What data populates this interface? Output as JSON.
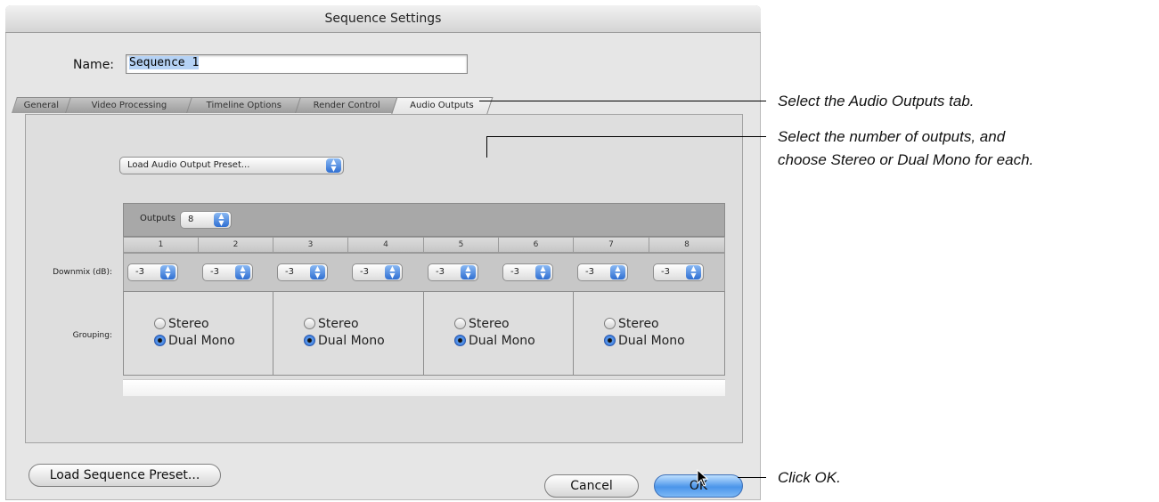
{
  "window": {
    "title": "Sequence Settings"
  },
  "name_field": {
    "label": "Name:",
    "value": "Sequence 1"
  },
  "tabs": [
    {
      "label": "General",
      "active": false
    },
    {
      "label": "Video Processing",
      "active": false
    },
    {
      "label": "Timeline Options",
      "active": false
    },
    {
      "label": "Render Control",
      "active": false
    },
    {
      "label": "Audio Outputs",
      "active": true
    }
  ],
  "preset_popup": {
    "label": "Load Audio Output Preset..."
  },
  "outputs": {
    "label": "Outputs",
    "value": "8"
  },
  "columns": [
    "1",
    "2",
    "3",
    "4",
    "5",
    "6",
    "7",
    "8"
  ],
  "downmix": {
    "label": "Downmix (dB):",
    "values": [
      "-3",
      "-3",
      "-3",
      "-3",
      "-3",
      "-3",
      "-3",
      "-3"
    ]
  },
  "grouping": {
    "label": "Grouping:",
    "groups": [
      {
        "options": [
          "Stereo",
          "Dual Mono"
        ],
        "selected": "Dual Mono"
      },
      {
        "options": [
          "Stereo",
          "Dual Mono"
        ],
        "selected": "Dual Mono"
      },
      {
        "options": [
          "Stereo",
          "Dual Mono"
        ],
        "selected": "Dual Mono"
      },
      {
        "options": [
          "Stereo",
          "Dual Mono"
        ],
        "selected": "Dual Mono"
      }
    ]
  },
  "buttons": {
    "load_preset": "Load Sequence Preset...",
    "cancel": "Cancel",
    "ok": "OK"
  },
  "callouts": {
    "tab": "Select the Audio Outputs tab.",
    "outputs_line1": "Select the number of outputs, and",
    "outputs_line2": "choose Stereo or Dual Mono for each.",
    "ok": "Click OK."
  },
  "colors": {
    "accent": "#2f6fd2",
    "window_bg": "#e6e6e6"
  }
}
